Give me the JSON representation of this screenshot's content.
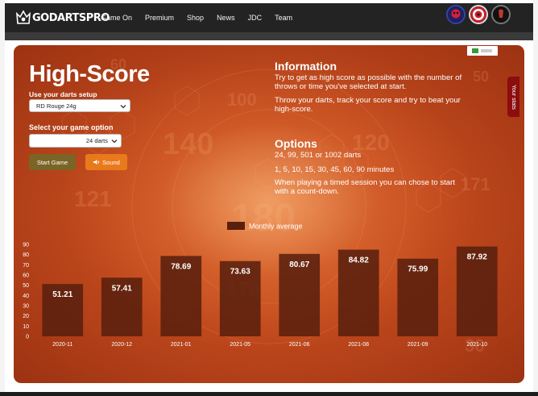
{
  "nav": {
    "logo": "GODARTSPRO",
    "links": [
      "Game On",
      "Premium",
      "Shop",
      "News",
      "JDC",
      "Team"
    ]
  },
  "page": {
    "title": "High-Score",
    "setup_label": "Use your darts setup",
    "setup_value": "RD Rouge 24g",
    "game_option_label": "Select your game option",
    "game_option_value": "24 darts",
    "start_button": "Start Game",
    "sound_button": "Sound",
    "sound_icon": "speaker-icon",
    "your_stats_tab": "Your stats"
  },
  "info": {
    "heading": "Information",
    "p1": "Try to get as high score as possible with the number of throws or time you've selected at start.",
    "p2": "Throw your darts, track your score and try to beat your high-score."
  },
  "options": {
    "heading": "Options",
    "line1": "24, 99, 501 or 1002 darts",
    "line2": "1, 5, 10, 15, 30, 45, 60, 90 minutes",
    "line3": "When playing a timed session you can chose to start with a count-down."
  },
  "colors": {
    "bar": "#5a200e",
    "accent_orange": "#e97a1b",
    "start_button": "#7b6526",
    "stats_tab": "#8b0d0d"
  },
  "chart_data": {
    "type": "bar",
    "categories": [
      "2020-11",
      "2020-12",
      "2021-01",
      "2021-05",
      "2021-06",
      "2021-08",
      "2021-09",
      "2021-10"
    ],
    "series": [
      {
        "name": "Monthly average",
        "values": [
          51.21,
          57.41,
          78.69,
          73.63,
          80.67,
          84.82,
          75.99,
          87.92
        ]
      }
    ],
    "ylim": [
      0,
      90
    ],
    "yticks": [
      0,
      10,
      20,
      30,
      40,
      50,
      60,
      70,
      80,
      90
    ],
    "legend": "top-center"
  }
}
